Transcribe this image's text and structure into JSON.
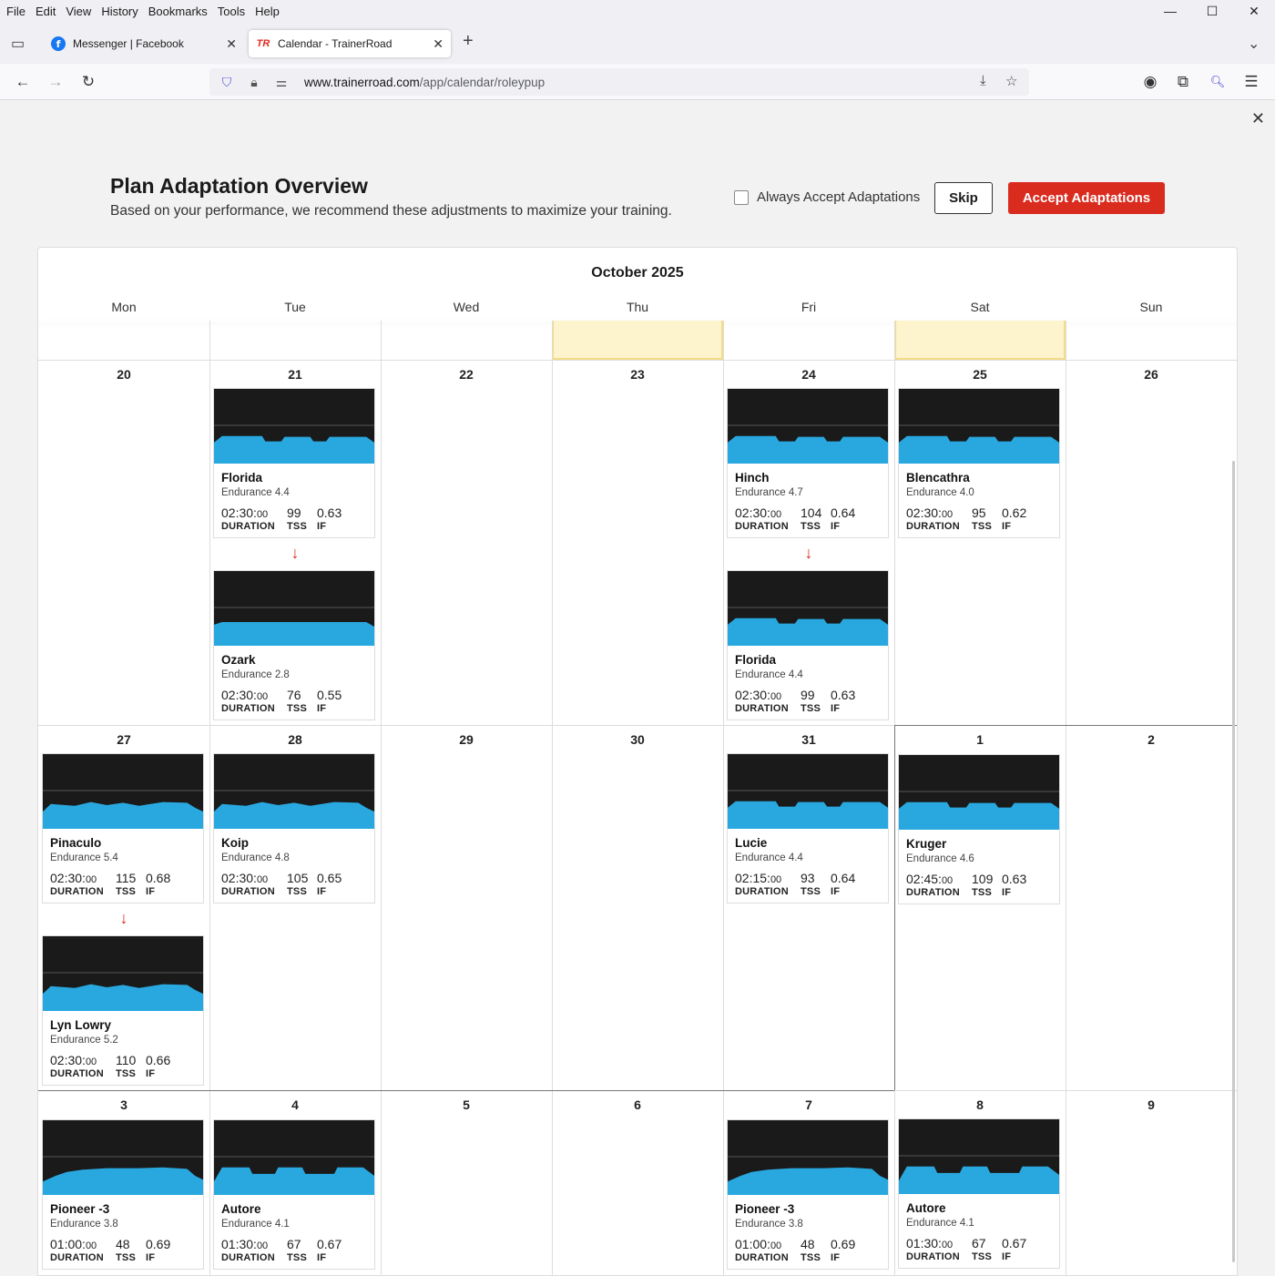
{
  "menu": [
    "File",
    "Edit",
    "View",
    "History",
    "Bookmarks",
    "Tools",
    "Help"
  ],
  "menu_accel": [
    "F",
    "E",
    "V",
    "H",
    "B",
    "T",
    "H"
  ],
  "tabs": [
    {
      "title": "Messenger | Facebook"
    },
    {
      "title": "Calendar - TrainerRoad"
    }
  ],
  "url": {
    "host": "www.trainerroad.com",
    "path": "/app/calendar/roleypup"
  },
  "header": {
    "title": "Plan Adaptation Overview",
    "subtitle": "Based on your performance, we recommend these adjustments to maximize your training.",
    "always_accept_label": "Always Accept Adaptations",
    "skip_label": "Skip",
    "accept_label": "Accept Adaptations"
  },
  "calendar": {
    "month": "October 2025",
    "weekdays": [
      "Mon",
      "Tue",
      "Wed",
      "Thu",
      "Fri",
      "Sat",
      "Sun"
    ],
    "weeks": [
      [
        "20",
        "21",
        "22",
        "23",
        "24",
        "25",
        "26"
      ],
      [
        "27",
        "28",
        "29",
        "30",
        "31",
        "1",
        "2"
      ],
      [
        "3",
        "4",
        "5",
        "6",
        "7",
        "8",
        "9"
      ]
    ],
    "stat_labels": {
      "duration": "DURATION",
      "tss": "TSS",
      "if": "IF"
    },
    "workouts": [
      {
        "name": "Florida",
        "level": "Endurance 4.4",
        "duration_main": "02:30:",
        "duration_sec": "00",
        "tss": "99",
        "if": "0.63"
      },
      {
        "name": "Ozark",
        "level": "Endurance 2.8",
        "duration_main": "02:30:",
        "duration_sec": "00",
        "tss": "76",
        "if": "0.55"
      },
      {
        "name": "Hinch",
        "level": "Endurance 4.7",
        "duration_main": "02:30:",
        "duration_sec": "00",
        "tss": "104",
        "if": "0.64"
      },
      {
        "name": "Florida",
        "level": "Endurance 4.4",
        "duration_main": "02:30:",
        "duration_sec": "00",
        "tss": "99",
        "if": "0.63"
      },
      {
        "name": "Blencathra",
        "level": "Endurance 4.0",
        "duration_main": "02:30:",
        "duration_sec": "00",
        "tss": "95",
        "if": "0.62"
      },
      {
        "name": "Pinaculo",
        "level": "Endurance 5.4",
        "duration_main": "02:30:",
        "duration_sec": "00",
        "tss": "115",
        "if": "0.68"
      },
      {
        "name": "Lyn Lowry",
        "level": "Endurance 5.2",
        "duration_main": "02:30:",
        "duration_sec": "00",
        "tss": "110",
        "if": "0.66"
      },
      {
        "name": "Koip",
        "level": "Endurance 4.8",
        "duration_main": "02:30:",
        "duration_sec": "00",
        "tss": "105",
        "if": "0.65"
      },
      {
        "name": "Lucie",
        "level": "Endurance 4.4",
        "duration_main": "02:15:",
        "duration_sec": "00",
        "tss": "93",
        "if": "0.64"
      },
      {
        "name": "Kruger",
        "level": "Endurance 4.6",
        "duration_main": "02:45:",
        "duration_sec": "00",
        "tss": "109",
        "if": "0.63"
      },
      {
        "name": "Pioneer -3",
        "level": "Endurance 3.8",
        "duration_main": "01:00:",
        "duration_sec": "00",
        "tss": "48",
        "if": "0.69"
      },
      {
        "name": "Autore",
        "level": "Endurance 4.1",
        "duration_main": "01:30:",
        "duration_sec": "00",
        "tss": "67",
        "if": "0.67"
      },
      {
        "name": "Pioneer -3",
        "level": "Endurance 3.8",
        "duration_main": "01:00:",
        "duration_sec": "00",
        "tss": "48",
        "if": "0.69"
      },
      {
        "name": "Autore",
        "level": "Endurance 4.1",
        "duration_main": "01:30:",
        "duration_sec": "00",
        "tss": "67",
        "if": "0.67"
      }
    ],
    "adaptation_arrow": "↓"
  },
  "colors": {
    "accent": "#d92c1f",
    "graph_fill": "#29a8e0",
    "graph_bg": "#1a1a1a",
    "highlight": "#fdf3cc"
  }
}
